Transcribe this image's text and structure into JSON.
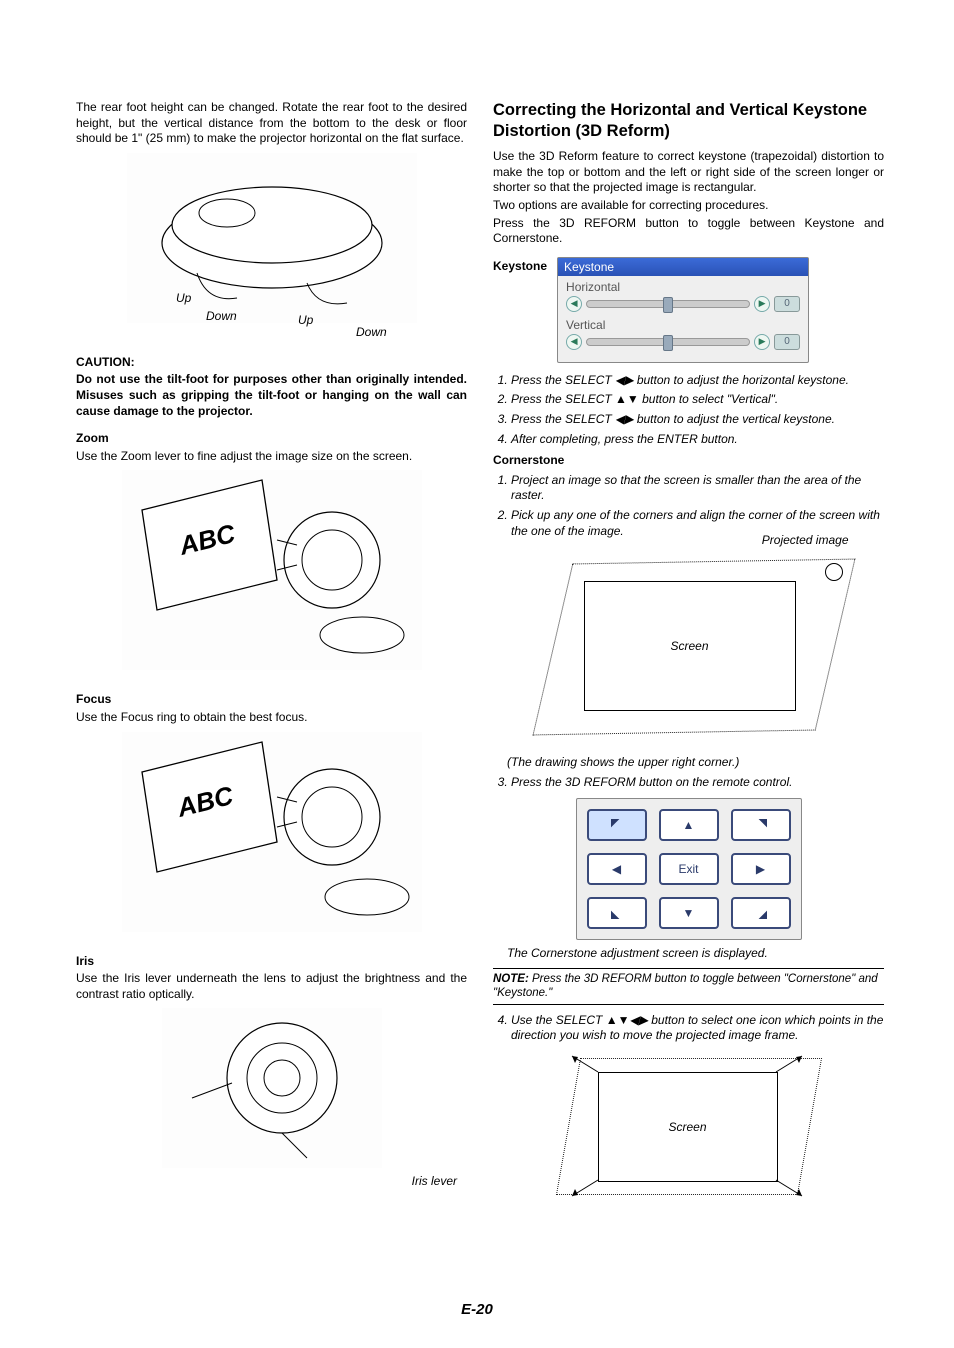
{
  "left": {
    "intro": "The rear foot height can be changed. Rotate the rear foot to the desired height, but the vertical distance from the bottom to the desk or floor should be 1\" (25 mm) to make the projector horizontal on the flat surface.",
    "fig1_labels": {
      "up": "Up",
      "down": "Down"
    },
    "caution_head": "CAUTION:",
    "caution_body": "Do not use the tilt-foot for purposes other than originally intended. Misuses such as gripping the tilt-foot or hanging on the wall can cause damage to the projector.",
    "zoom_head": "Zoom",
    "zoom_body": "Use the Zoom lever to fine adjust the image size on the screen.",
    "focus_head": "Focus",
    "focus_body": "Use the Focus ring to obtain the best focus.",
    "iris_head": "Iris",
    "iris_body": "Use the Iris lever underneath the lens to adjust the brightness and the contrast ratio optically.",
    "iris_label": "Iris lever",
    "abc": "ABC"
  },
  "right": {
    "heading": "Correcting the Horizontal and Vertical Keystone Distortion (3D Reform)",
    "intro1": "Use the 3D Reform feature to correct keystone (trapezoidal) distortion to make the top or bottom and the left or right side of the screen longer or shorter so that the projected image is rectangular.",
    "intro2": "Two options are available for correcting procedures.",
    "intro3": "Press the 3D REFORM button to toggle between Keystone and Cornerstone.",
    "keystone_label": "Keystone",
    "ks_panel": {
      "title": "Keystone",
      "h": "Horizontal",
      "v": "Vertical",
      "val": "0"
    },
    "steps_keystone": [
      "Press the SELECT ◀▶ button to adjust the horizontal keystone.",
      "Press the SELECT ▲▼ button to select \"Vertical\".",
      "Press the SELECT ◀▶ button to adjust the vertical keystone.",
      "After completing, press the ENTER button."
    ],
    "cornerstone_head": "Cornerstone",
    "steps_corner1": [
      "Project an image so that the screen is smaller than the area of the raster.",
      "Pick up any one of the corners and align the corner of the screen with the one of the image."
    ],
    "proj_label": "Projected image",
    "screen_label": "Screen",
    "corner_caption": "(The drawing shows the upper right corner.)",
    "step3": "Press the 3D REFORM button on the remote control.",
    "exit": "Exit",
    "cs_caption": "The Cornerstone adjustment screen is displayed.",
    "note": "Press the 3D REFORM button to toggle between \"Cornerstone\" and \"Keystone.\"",
    "note_head": "NOTE:",
    "step4": "Use the SELECT ▲▼◀▶ button to select one icon which points in the direction you wish to move the projected image frame."
  },
  "page_num": "E-20"
}
